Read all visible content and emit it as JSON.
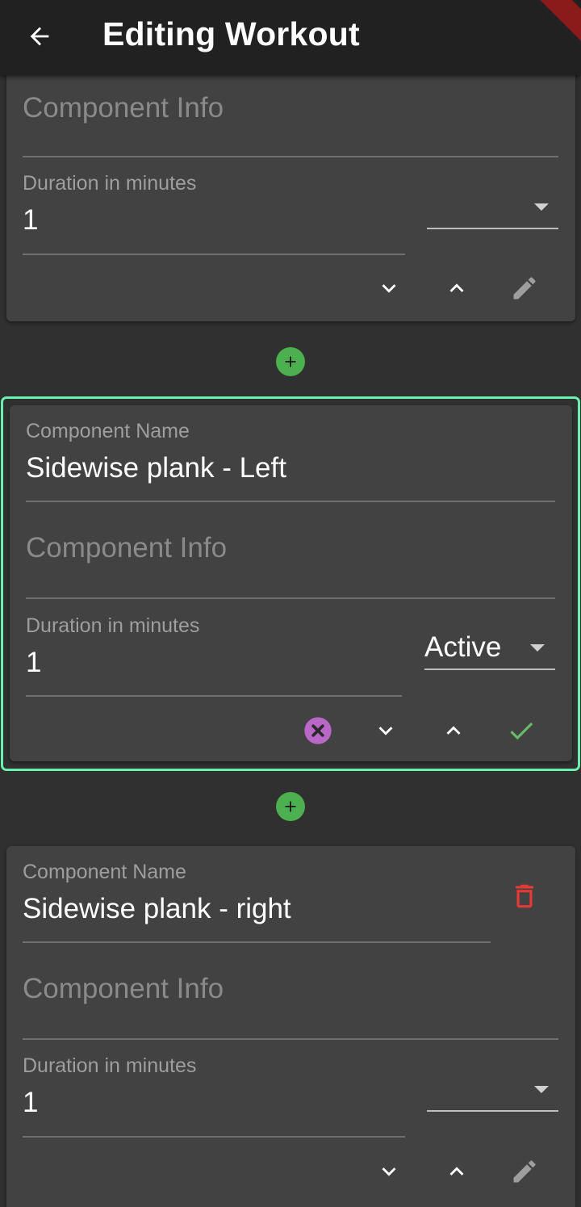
{
  "app_bar": {
    "title": "Editing Workout",
    "back_icon": "arrow-back-icon"
  },
  "colors": {
    "background": "#303030",
    "card": "#424242",
    "app_bar": "#212121",
    "focus_ring": "#69f0ae",
    "add_button": "#4caf50",
    "delete": "#e53935",
    "cancel": "#ba68c8",
    "confirm": "#66bb6a"
  },
  "cards": [
    {
      "info_placeholder": "Component Info",
      "duration_label": "Duration in minutes",
      "duration_value": "1",
      "type_value": "",
      "actions": [
        "chevron-down-icon",
        "chevron-up-icon",
        "edit-icon"
      ]
    },
    {
      "name_label": "Component Name",
      "name_value": "Sidewise plank - Left",
      "info_placeholder": "Component Info",
      "duration_label": "Duration in minutes",
      "duration_value": "1",
      "type_value": "Active",
      "actions": [
        "cancel-icon",
        "chevron-down-icon",
        "chevron-up-icon",
        "check-icon"
      ]
    },
    {
      "name_label": "Component Name",
      "name_value": "Sidewise plank - right",
      "info_placeholder": "Component Info",
      "duration_label": "Duration in minutes",
      "duration_value": "1",
      "type_value": "",
      "actions": [
        "delete-icon",
        "chevron-down-icon",
        "chevron-up-icon",
        "edit-icon"
      ]
    }
  ],
  "add_component_icon": "add-circle-icon"
}
